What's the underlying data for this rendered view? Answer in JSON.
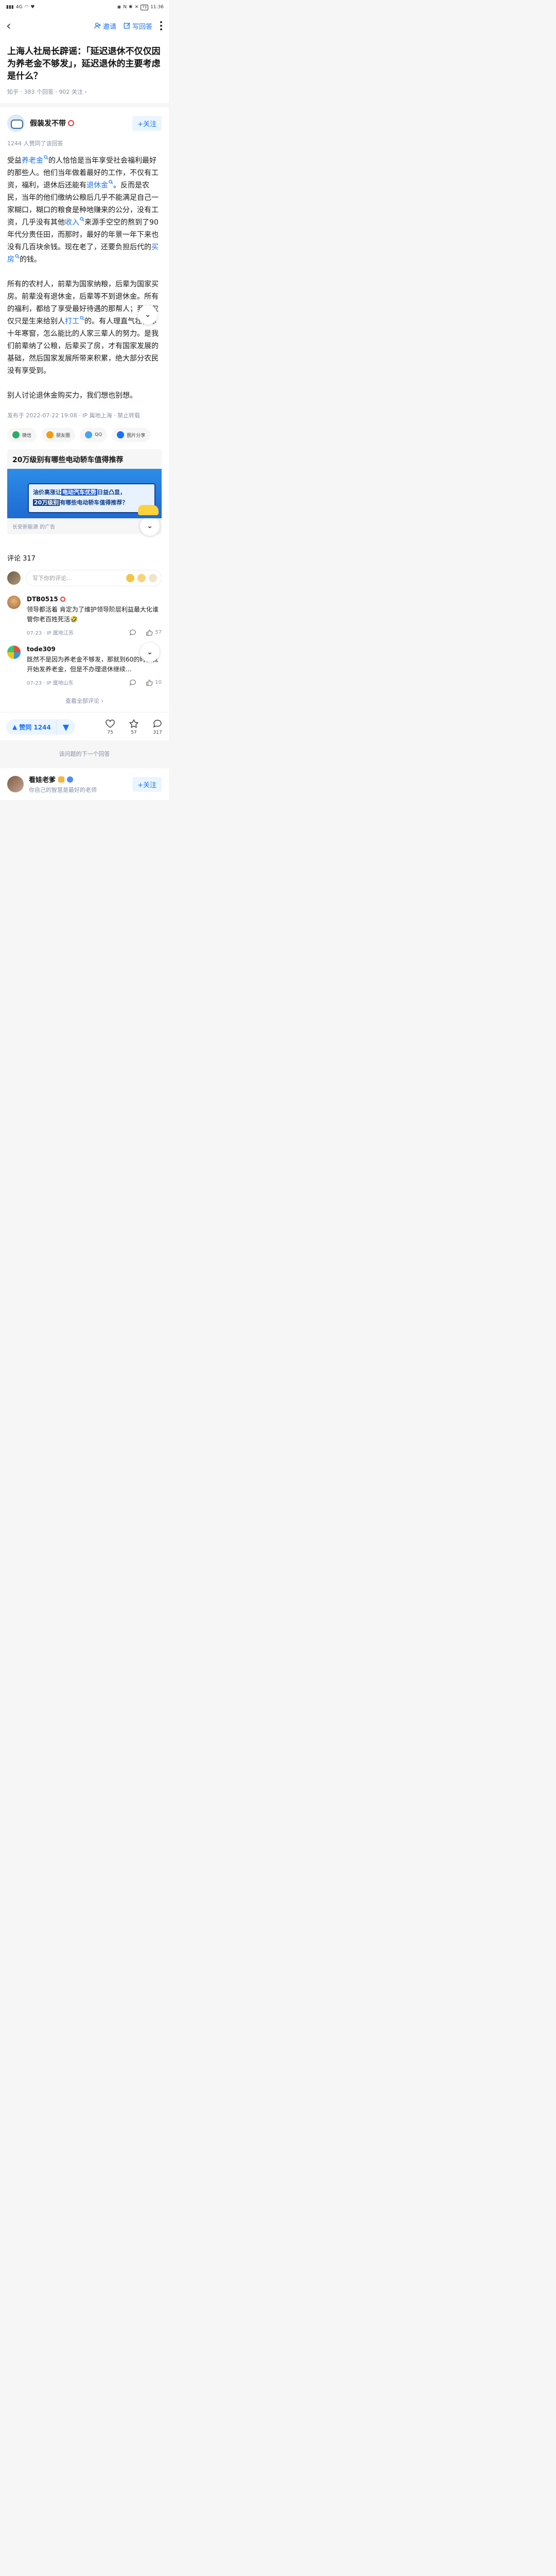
{
  "status_bar": {
    "time": "11:36",
    "battery": "73",
    "network": "4G"
  },
  "nav": {
    "invite_label": "邀请",
    "write_label": "写回答"
  },
  "question": {
    "title": "上海人社局长辟谣：「延迟退休不仅仅因为养老金不够发」，延迟退休的主要考虑是什么？",
    "meta": "知乎 · 383 个回答 · 902 关注 ›"
  },
  "answer": {
    "author": "假装发不带",
    "follow_label": "+关注",
    "upvoted_text": "1244 人赞同了该回答",
    "paragraphs": [
      [
        {
          "t": "受益"
        },
        {
          "t": "养老金",
          "kw": true
        },
        {
          "t": "的人恰恰是当年享受社会福利最好的那些人。他们当年做着最好的工作，不仅有工资，福利，退休后还能有"
        },
        {
          "t": "退休金",
          "kw": true
        },
        {
          "t": "。反而是农民，当年的他们缴纳公粮后几乎不能满足自己一家糊口，糊口的粮食是种地赚来的公分，没有工资，几乎没有其他"
        },
        {
          "t": "收入",
          "kw": true
        },
        {
          "t": "来源手空空的熬到了90年代分责任田，而那时，最好的年景一年下来也没有几百块余钱。现在老了，还要负担后代的"
        },
        {
          "t": "买房",
          "kw": true
        },
        {
          "t": "的钱。"
        }
      ],
      [
        {
          "t": "所有的农村人，前辈为国家纳粮，后辈为国家买房。前辈没有退休金，后辈等不到退休金。所有的福利，都给了享受最好待遇的那帮人；我们仅仅只是生来给别人"
        },
        {
          "t": "打工",
          "kw": true
        },
        {
          "t": "的。有人理直气壮，你十年寒窗，怎么能比的人家三辈人的努力。是我们前辈纳了公粮，后辈买了房，才有国家发展的基础，然后国家发展所带来积累，绝大部分农民没有享受到。"
        }
      ],
      [
        {
          "t": "别人讨论退休金购买力，我们想也别想。"
        }
      ]
    ],
    "published": "发布于 2022-07-22 19:08 · IP 属地上海 · 禁止转载",
    "share": [
      {
        "label": "微信",
        "icon": "wechat-icon",
        "color": "#2aae67"
      },
      {
        "label": "朋友圈",
        "icon": "moments-icon",
        "color": "#f39c12"
      },
      {
        "label": "QQ",
        "icon": "qq-icon",
        "color": "#4aa3f0"
      },
      {
        "label": "图片分享",
        "icon": "image-share-icon",
        "color": "#1772f6"
      }
    ]
  },
  "ad": {
    "title": "20万级别有哪些电动轿车值得推荐",
    "line1_a": "油价高涨让",
    "line1_hl": "电动汽车优势",
    "line1_b": "日益凸显，",
    "line2_hl": "20万级别",
    "line2_b": "有哪些电动轿车值得推荐？",
    "source": "长安新能源 的广告",
    "close": "✕"
  },
  "comments": {
    "count_label": "评论 317",
    "input_placeholder": "写下你的评论...",
    "items": [
      {
        "name": "DTB0515",
        "text": "领导都活着 肯定为了维护领导阶层利益最大化谁管你老百姓死活🤣",
        "meta": "07-23 · IP 属地江苏",
        "likes": "57"
      },
      {
        "name": "tode309",
        "text": "既然不是因为养老金不够发，那就到60的时候就开始发养老金，但是不办理退休继续...",
        "meta": "07-23 · IP 属地山东",
        "likes": "10"
      }
    ],
    "view_all": "查看全部评论 ›"
  },
  "actions": {
    "upvote_label": "赞同 1244",
    "like_count": "75",
    "favorite_count": "57",
    "comment_count": "317"
  },
  "next_answer_label": "该问题的下一个回答",
  "next_card": {
    "name": "看娃老爹",
    "bio": "你自己的智慧是最好的老师",
    "follow_label": "+关注"
  }
}
